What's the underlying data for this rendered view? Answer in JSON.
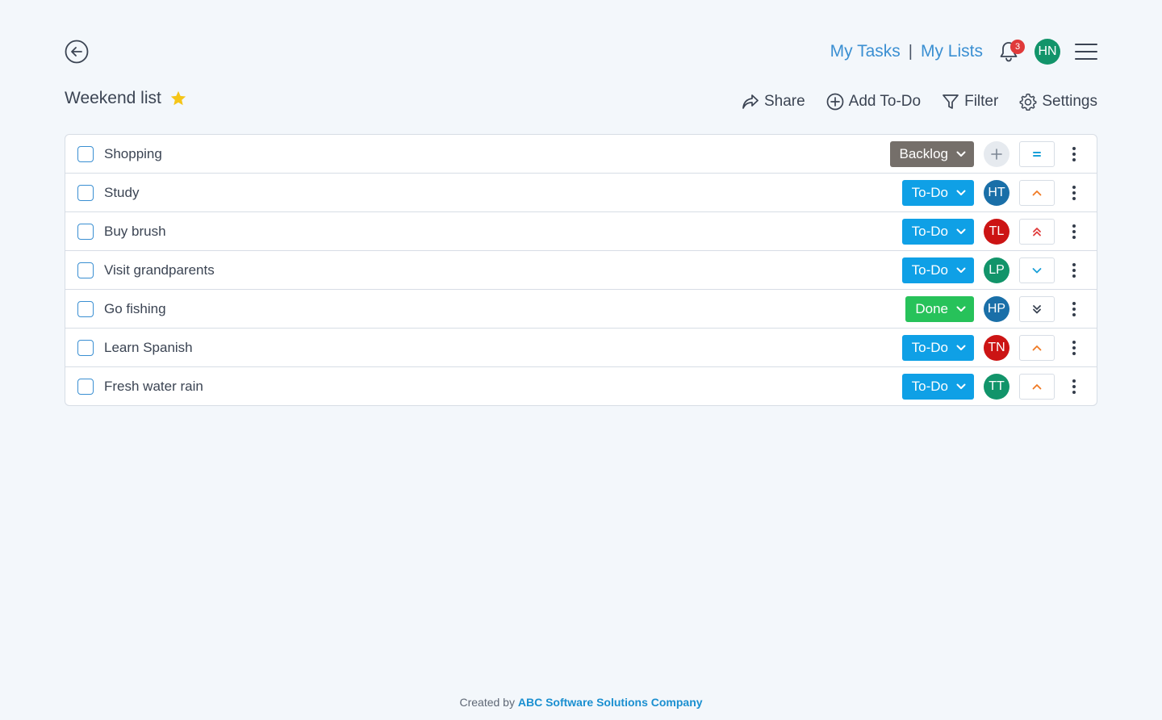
{
  "nav": {
    "my_tasks": "My Tasks",
    "separator": "|",
    "my_lists": "My Lists",
    "notification_count": "3",
    "user_initials": "HN",
    "user_color": "#12946a"
  },
  "list": {
    "title": "Weekend list",
    "starred": true
  },
  "toolbar": {
    "share": "Share",
    "add_todo": "Add To-Do",
    "filter": "Filter",
    "settings": "Settings"
  },
  "tasks": [
    {
      "name": "Shopping",
      "status": "Backlog",
      "status_color": "#756f6a",
      "assignee": "+",
      "assignee_color": "#e6eaef",
      "priority": "medium",
      "priority_icon": "equals-icon"
    },
    {
      "name": "Study",
      "status": "To-Do",
      "status_color": "#0fa0e6",
      "assignee": "HT",
      "assignee_color": "#1a6fa8",
      "priority": "high",
      "priority_icon": "chevron-up-icon"
    },
    {
      "name": "Buy brush",
      "status": "To-Do",
      "status_color": "#0fa0e6",
      "assignee": "TL",
      "assignee_color": "#cc1414",
      "priority": "highest",
      "priority_icon": "double-chevron-up-icon"
    },
    {
      "name": "Visit grandparents",
      "status": "To-Do",
      "status_color": "#0fa0e6",
      "assignee": "LP",
      "assignee_color": "#12946a",
      "priority": "low",
      "priority_icon": "chevron-down-icon"
    },
    {
      "name": "Go fishing",
      "status": "Done",
      "status_color": "#27c25a",
      "assignee": "HP",
      "assignee_color": "#1a6fa8",
      "priority": "lowest",
      "priority_icon": "double-chevron-down-icon"
    },
    {
      "name": "Learn Spanish",
      "status": "To-Do",
      "status_color": "#0fa0e6",
      "assignee": "TN",
      "assignee_color": "#cc1414",
      "priority": "high",
      "priority_icon": "chevron-up-icon"
    },
    {
      "name": "Fresh water rain",
      "status": "To-Do",
      "status_color": "#0fa0e6",
      "assignee": "TT",
      "assignee_color": "#12946a",
      "priority": "high",
      "priority_icon": "chevron-up-icon"
    }
  ],
  "footer": {
    "prefix": "Created by",
    "company": "ABC Software Solutions Company"
  }
}
